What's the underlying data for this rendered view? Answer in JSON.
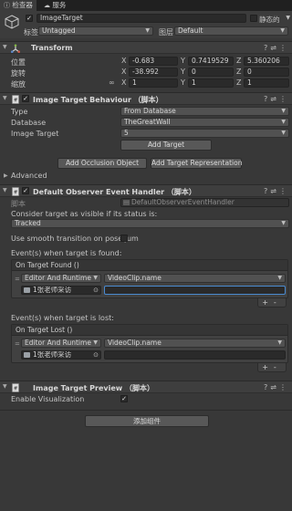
{
  "tabs": [
    {
      "label": "检查器",
      "active": true
    },
    {
      "label": "服务",
      "active": false
    }
  ],
  "gameobject": {
    "name": "ImageTarget",
    "static_label": "静态的",
    "tag_label": "标签",
    "tag_value": "Untagged",
    "layer_label": "图层",
    "layer_value": "Default"
  },
  "transform": {
    "title": "Transform",
    "position_label": "位置",
    "rotation_label": "旋转",
    "scale_label": "缩放",
    "position": {
      "x": "-0.683",
      "y": "0.7419529",
      "z": "5.360206"
    },
    "rotation": {
      "x": "-38.992",
      "y": "0",
      "z": "0"
    },
    "scale": {
      "x": "1",
      "y": "1",
      "z": "1"
    },
    "axis": {
      "x": "X",
      "y": "Y",
      "z": "Z"
    }
  },
  "itb": {
    "title": "Image Target Behaviour （脚本）",
    "type_label": "Type",
    "type_value": "From Database",
    "database_label": "Database",
    "database_value": "TheGreatWall",
    "image_target_label": "Image Target",
    "image_target_value": "5",
    "add_target_btn": "Add Target",
    "advanced_label": "Advanced",
    "add_occlusion_btn": "Add Occlusion Object",
    "add_representation_btn": "Add Target Representation"
  },
  "doeh": {
    "title": "Default Observer Event Handler （脚本）",
    "script_label": "脚本",
    "script_value": "DefaultObserverEventHandler",
    "consider_label": "Consider target as visible if its status is:",
    "status_value": "Tracked",
    "smooth_label": "Use smooth transition on pose jum",
    "found_section": "Event(s) when target is found:",
    "found_header": "On Target Found ()",
    "lost_section": "Event(s) when target is lost:",
    "lost_header": "On Target Lost ()",
    "runtime_value": "Editor And Runtime",
    "function_value": "VideoClip.name",
    "object_value": "1张老师采访",
    "arg_value": "",
    "plus": "+",
    "minus": "-"
  },
  "preview": {
    "title": "Image Target Preview （脚本）",
    "enable_label": "Enable Visualization"
  },
  "add_component_btn": "添加组件"
}
